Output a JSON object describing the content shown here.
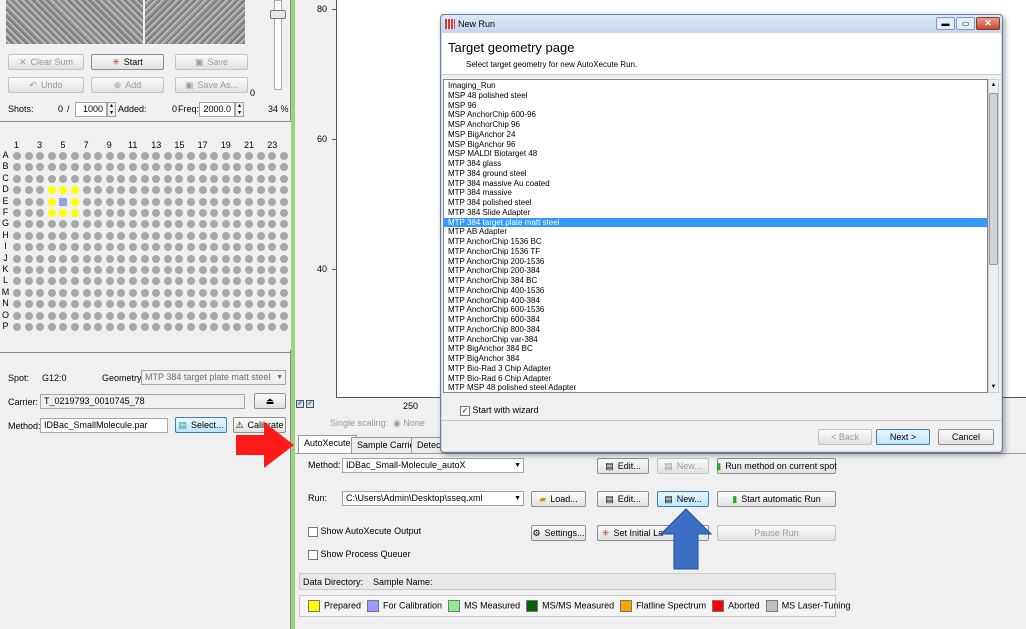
{
  "left": {
    "buttons": {
      "clear_sum": "Clear Sum",
      "start": "Start",
      "save": "Save",
      "undo": "Undo",
      "add": "Add",
      "save_as": "Save As..."
    },
    "slider_value": "0",
    "shots": {
      "label": "Shots:",
      "value": "0",
      "sep": "/",
      "total": "1000",
      "added_label": "Added:",
      "added": "0",
      "freq_label": "Freq:",
      "freq": "2000.0",
      "percent": "34 %"
    },
    "plate": {
      "col_labels": [
        "1",
        "3",
        "5",
        "7",
        "9",
        "11",
        "13",
        "15",
        "17",
        "19",
        "21",
        "23"
      ],
      "row_labels": [
        "A",
        "B",
        "C",
        "D",
        "E",
        "F",
        "G",
        "H",
        "I",
        "J",
        "K",
        "L",
        "M",
        "N",
        "O",
        "P"
      ]
    },
    "spot": {
      "label": "Spot:",
      "value": "G12:0",
      "geometry_label": "Geometry:",
      "geometry": "MTP 384 target plate matt steel"
    },
    "carrier": {
      "label": "Carrier:",
      "value": "T_0219793_0010745_78"
    },
    "method": {
      "label": "Method:",
      "value": "IDBac_SmallMolecule.par",
      "select": "Select...",
      "calibrate": "Calibrate"
    }
  },
  "chart": {
    "yticks": [
      "80",
      "60",
      "40"
    ],
    "xtick": "250",
    "scaling_label": "Single scaling:",
    "scaling_option": "None"
  },
  "bottom": {
    "tabs": [
      "AutoXecute",
      "Sample Carrier",
      "Detecti"
    ],
    "method_label": "Method:",
    "method_value": "IDBac_Small-Molecule_autoX",
    "run_label": "Run:",
    "run_value": "C:\\Users\\Admin\\Desktop\\sseq.xml",
    "buttons": {
      "edit1": "Edit...",
      "new1": "New...",
      "run_method": "Run method on current spot",
      "load": "Load...",
      "edit2": "Edit...",
      "new2": "New...",
      "start_auto": "Start automatic Run",
      "settings": "Settings...",
      "set_initial": "Set Initial La",
      "pause": "Pause Run"
    },
    "chk_autox": "Show AutoXecute Output",
    "chk_queuer": "Show Process Queuer",
    "data_dir_label": "Data Directory:",
    "sample_name_label": "Sample Name:",
    "legend": [
      {
        "label": "Prepared",
        "color": "#ffff00"
      },
      {
        "label": "For Calibration",
        "color": "#9999ff"
      },
      {
        "label": "MS Measured",
        "color": "#90ee90"
      },
      {
        "label": "MS/MS Measured",
        "color": "#006400"
      },
      {
        "label": "Flatline Spectrum",
        "color": "#ffa500"
      },
      {
        "label": "Aborted",
        "color": "#ff0000"
      },
      {
        "label": "MS Laser-Tuning",
        "color": "#c0c0c0"
      }
    ]
  },
  "dialog": {
    "title": "New Run",
    "heading": "Target geometry page",
    "subheading": "Select target geometry for new AutoXecute Run.",
    "items": [
      "Imaging_Run",
      "MSP 48 polished steel",
      "MSP 96",
      "MSP AnchorChip 600-96",
      "MSP AnchorChip 96",
      "MSP BigAnchor 24",
      "MSP BigAnchor 96",
      "MSP MALDI Biotarget 48",
      "MTP 384 glass",
      "MTP 384 ground steel",
      "MTP 384 massive Au coated",
      "MTP 384 massive",
      "MTP 384 polished steel",
      "MTP 384 Slide Adapter",
      "MTP 384 target plate matt steel",
      "MTP AB Adapter",
      "MTP AnchorChip 1536 BC",
      "MTP AnchorChip 1536 TF",
      "MTP AnchorChip 200-1536",
      "MTP AnchorChip 200-384",
      "MTP AnchorChip 384 BC",
      "MTP AnchorChip 400-1536",
      "MTP AnchorChip 400-384",
      "MTP AnchorChip 600-1536",
      "MTP AnchorChip 600-384",
      "MTP AnchorChip 800-384",
      "MTP AnchorChip var-384",
      "MTP BigAnchor 384 BC",
      "MTP BigAnchor 384",
      "MTP Bio-Rad 3 Chip Adapter",
      "MTP Bio-Rad 6 Chip Adapter",
      "MTP MSP 48 polished steel Adapter"
    ],
    "selected_index": 14,
    "start_with_wizard": "Start with wizard",
    "back": "< Back",
    "next": "Next >",
    "cancel": "Cancel"
  }
}
